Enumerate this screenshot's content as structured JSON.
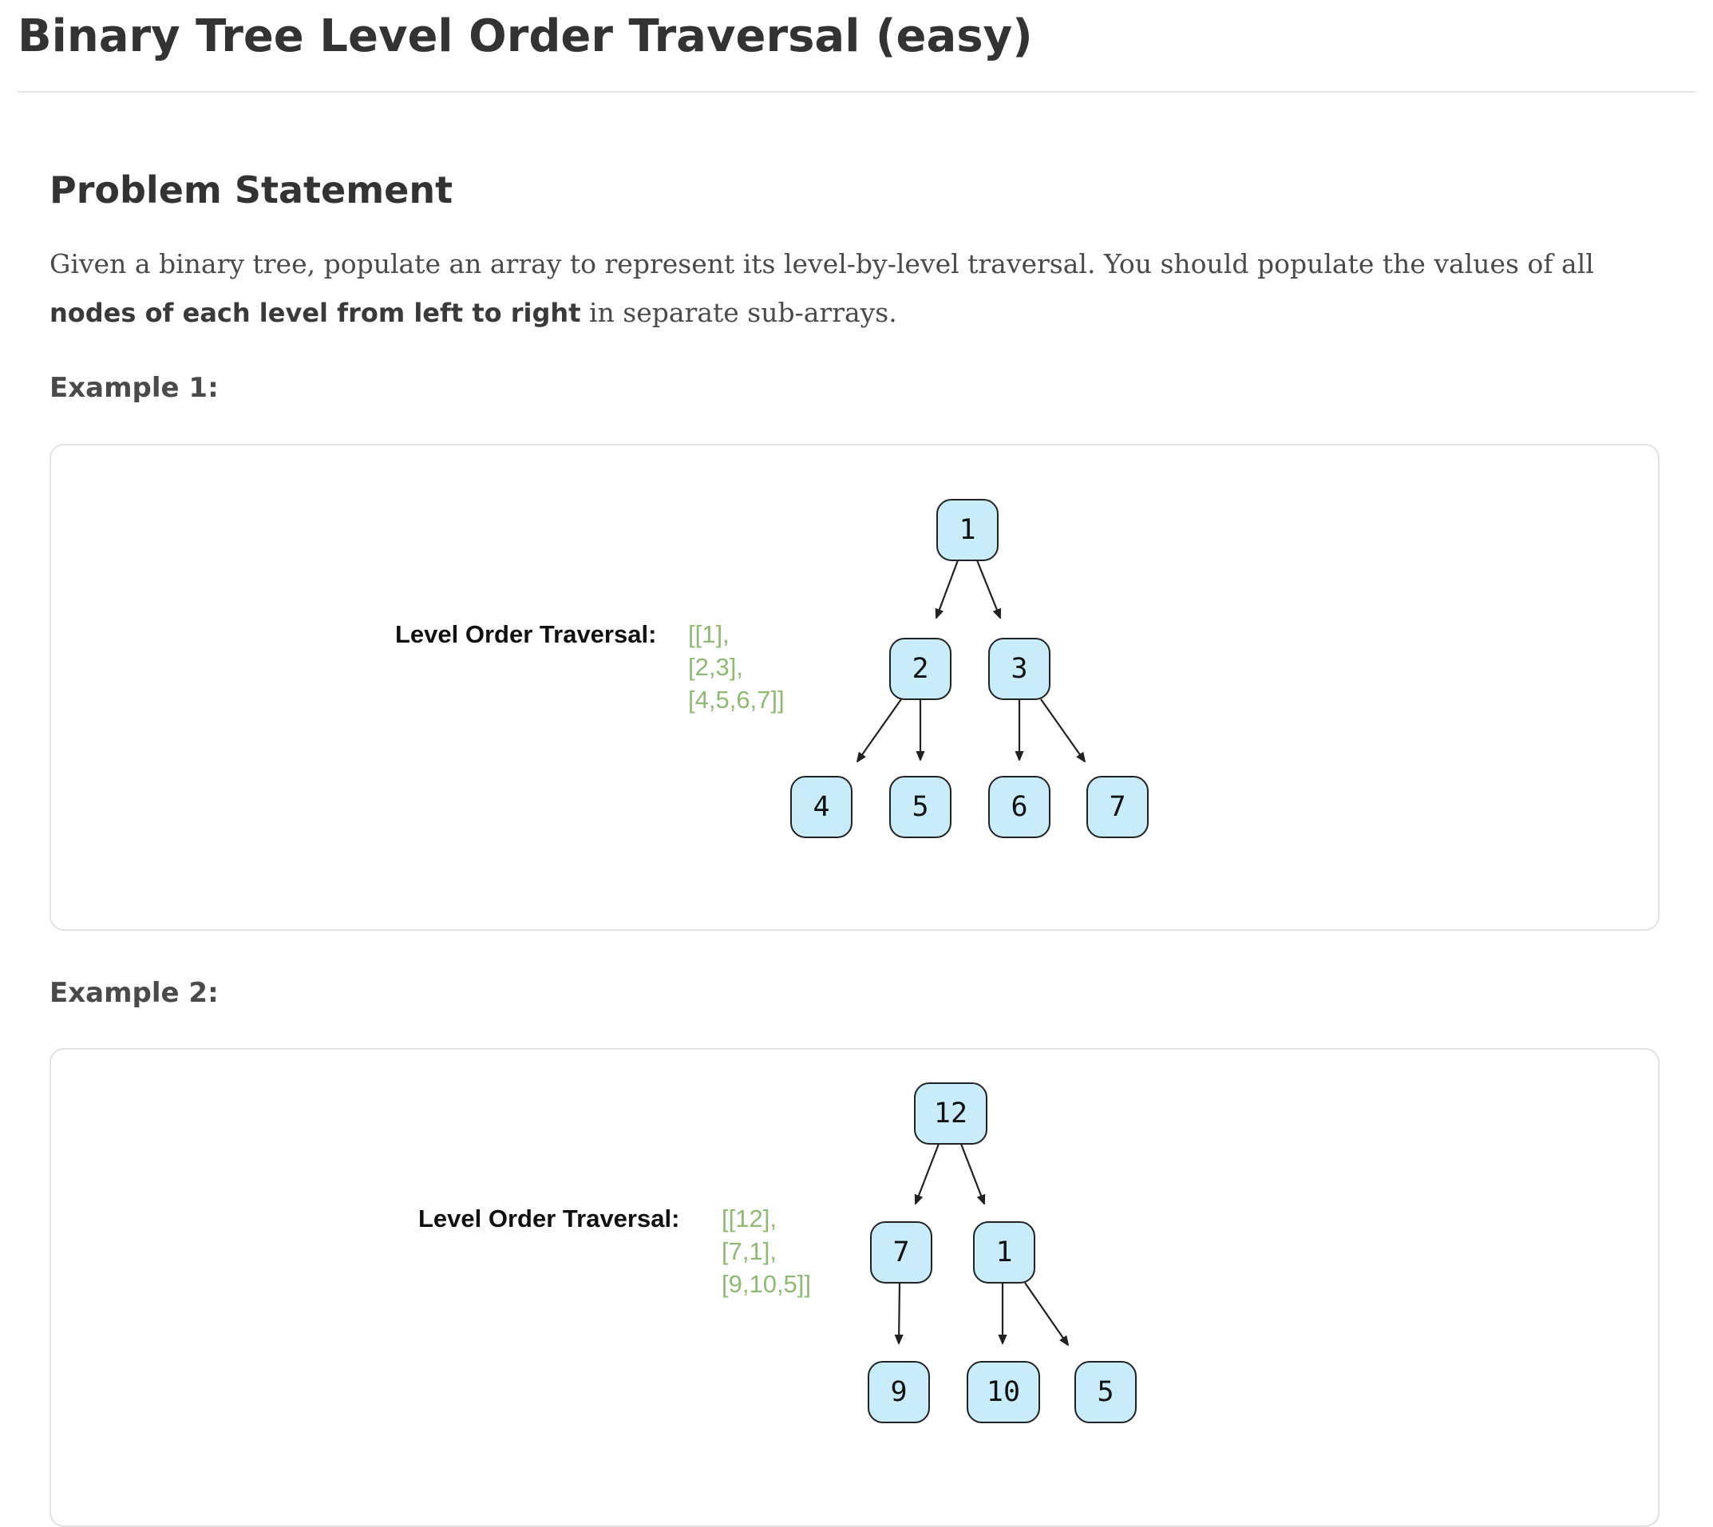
{
  "page": {
    "title": "Binary Tree Level Order Traversal (easy)"
  },
  "problem": {
    "heading": "Problem Statement",
    "text_1": "Given a binary tree, populate an array to represent its level-by-level traversal. You should populate the values of all ",
    "text_bold": "nodes of each level from left to right",
    "text_2": " in separate sub-arrays."
  },
  "examples": [
    {
      "label": "Example 1:",
      "traversal_label": "Level Order Traversal:",
      "traversal_lines": [
        "[[1],",
        "[2,3],",
        "[4,5,6,7]]"
      ],
      "tree": {
        "nodes": [
          "1",
          "2",
          "3",
          "4",
          "5",
          "6",
          "7"
        ],
        "edges": [
          [
            "1",
            "2"
          ],
          [
            "1",
            "3"
          ],
          [
            "2",
            "4"
          ],
          [
            "2",
            "5"
          ],
          [
            "3",
            "6"
          ],
          [
            "3",
            "7"
          ]
        ]
      }
    },
    {
      "label": "Example 2:",
      "traversal_label": "Level Order Traversal:",
      "traversal_lines": [
        "[[12],",
        "[7,1],",
        "[9,10,5]]"
      ],
      "tree": {
        "nodes": [
          "12",
          "7",
          "1",
          "9",
          "10",
          "5"
        ],
        "edges": [
          [
            "12",
            "7"
          ],
          [
            "12",
            "1"
          ],
          [
            "7",
            "9"
          ],
          [
            "1",
            "10"
          ],
          [
            "1",
            "5"
          ]
        ]
      }
    }
  ],
  "colors": {
    "node_fill": "#c9ecfb",
    "result_text": "#8fba73"
  }
}
